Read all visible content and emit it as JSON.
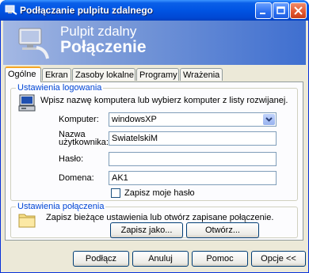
{
  "window": {
    "title": "Podłączanie pulpitu zdalnego"
  },
  "banner": {
    "line1": "Pulpit zdalny",
    "line2": "Połączenie"
  },
  "tabs": [
    {
      "label": "Ogólne"
    },
    {
      "label": "Ekran"
    },
    {
      "label": "Zasoby lokalne"
    },
    {
      "label": "Programy"
    },
    {
      "label": "Wrażenia"
    }
  ],
  "login_group": {
    "title": "Ustawienia logowania",
    "description": "Wpisz nazwę komputera lub wybierz komputer z listy rozwijanej.",
    "computer_label": "Komputer:",
    "computer_value": "windowsXP",
    "username_label_1": "Nazwa",
    "username_label_2": "użytkownika:",
    "username_value": "SwiatelskiM",
    "password_label": "Hasło:",
    "password_value": "",
    "domain_label": "Domena:",
    "domain_value": "AK1",
    "save_password_label": "Zapisz moje hasło"
  },
  "connection_group": {
    "title": "Ustawienia połączenia",
    "description": "Zapisz bieżące ustawienia lub otwórz zapisane połączenie.",
    "save_as_label": "Zapisz jako...",
    "open_label": "Otwórz..."
  },
  "buttons": {
    "connect": "Podłącz",
    "cancel": "Anuluj",
    "help": "Pomoc",
    "options": "Opcje <<"
  }
}
